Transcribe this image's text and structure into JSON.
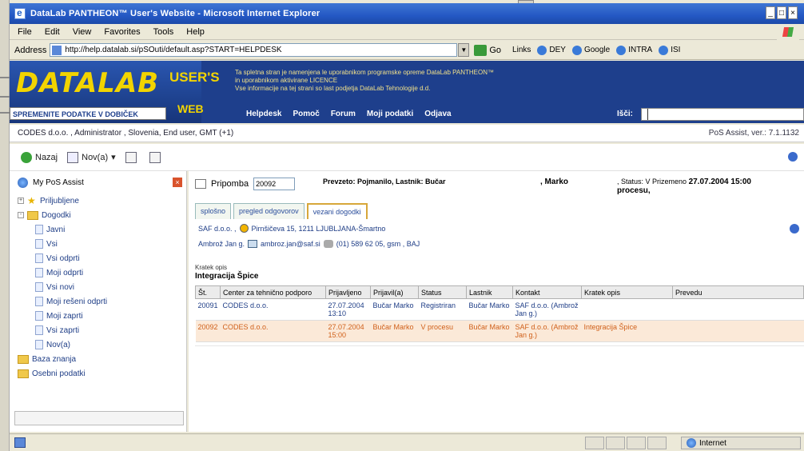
{
  "window": {
    "title": "DataLab PANTHEON™ User's Website - Microsoft Internet Explorer",
    "controls": [
      "_",
      "□",
      "×"
    ]
  },
  "menu": [
    "File",
    "Edit",
    "View",
    "Favorites",
    "Tools",
    "Help"
  ],
  "address": {
    "label": "Address",
    "url": "http://help.datalab.si/pSOuti/default.asp?START=HELPDESK",
    "go_label": "Go",
    "links": [
      "Links",
      "DEY",
      "Google",
      "INTRA",
      "ISI"
    ]
  },
  "banner": {
    "logo": "DATALAB",
    "users": "USER'S",
    "web": "WEB",
    "tagline": "SPREMENITE PODATKE V DOBIČEK",
    "notice_lines": [
      "Ta spletna stran je namenjena le uporabnikom programske opreme DataLab PANTHEON™",
      "in uporabnikom aktivirane LICENCE",
      "Vse informacije na tej strani so last podjetja DataLab Tehnologije d.d."
    ],
    "nav": [
      "Helpdesk",
      "Pomoč",
      "Forum",
      "Moji podatki",
      "Odjava"
    ],
    "search_label": "Išči:"
  },
  "session": {
    "left": "CODES d.o.o. , Administrator , Slovenia, End user, GMT (+1)",
    "right": "PoS Assist, ver.: 7.1.1132"
  },
  "toolbar": {
    "items": [
      "Nazaj",
      "Nov(a)",
      "",
      ""
    ]
  },
  "left_nav": {
    "header": "My PoS Assist",
    "close": "×",
    "tree": [
      {
        "label": "Priljubljene",
        "level": 0,
        "expander": "+"
      },
      {
        "label": "Dogodki",
        "level": 0,
        "expander": "-"
      },
      {
        "label": "Javni",
        "level": 1
      },
      {
        "label": "Vsi",
        "level": 1
      },
      {
        "label": "Vsi odprti",
        "level": 1
      },
      {
        "label": "Moji odprti",
        "level": 1
      },
      {
        "label": "Vsi novi",
        "level": 1
      },
      {
        "label": "Moji rešeni odprti",
        "level": 1
      },
      {
        "label": "Moji zaprti",
        "level": 1
      },
      {
        "label": "Vsi zaprti",
        "level": 1
      },
      {
        "label": "Nov(a)",
        "level": 1
      },
      {
        "label": "Baza znanja",
        "level": 0
      },
      {
        "label": "Osebni podatki",
        "level": 0
      }
    ]
  },
  "record": {
    "type_label": "Pripomba",
    "number": "20092",
    "owner_line": "Prevzeto: Pojmanilo, Lastnik: Bučar",
    "owner_name": ", Marko",
    "status_line": ", Status: V Prizemeno",
    "status_date": "27.07.2004 15:00",
    "status_tail": "procesu,",
    "tabs": [
      "splošno",
      "pregled odgovorov",
      "vezani dogodki"
    ],
    "contact_company": "SAF d.o.o. ,",
    "contact_address": "Pirnšičeva 15, 1211 LJUBLJANA-Šmartno",
    "contact_person": "Ambrož Jan g.",
    "contact_email": "ambroz.jan@saf.si",
    "contact_phone": "(01) 589 62 05, gsm , BAJ",
    "short_label": "Kratek opis",
    "short_value": "Integracija Špice"
  },
  "table": {
    "columns": [
      "Št.",
      "Center za tehnično podporo",
      "Prijavljeno",
      "Prijavil(a)",
      "Status",
      "Lastnik",
      "Kontakt",
      "Kratek opis",
      "Prevedu"
    ],
    "rows": [
      [
        "20091",
        "CODES d.o.o.",
        "27.07.2004 13:10",
        "Bučar Marko",
        "Registriran",
        "Bučar Marko",
        "SAF d.o.o. (Ambrož Jan g.)",
        "",
        ""
      ],
      [
        "20092",
        "CODES d.o.o.",
        "27.07.2004 15:00",
        "Bučar Marko",
        "V procesu",
        "Bučar Marko",
        "SAF d.o.o. (Ambrož Jan g.)",
        "Integracija Špice",
        ""
      ]
    ]
  },
  "statusbar": {
    "zone": "Internet"
  }
}
